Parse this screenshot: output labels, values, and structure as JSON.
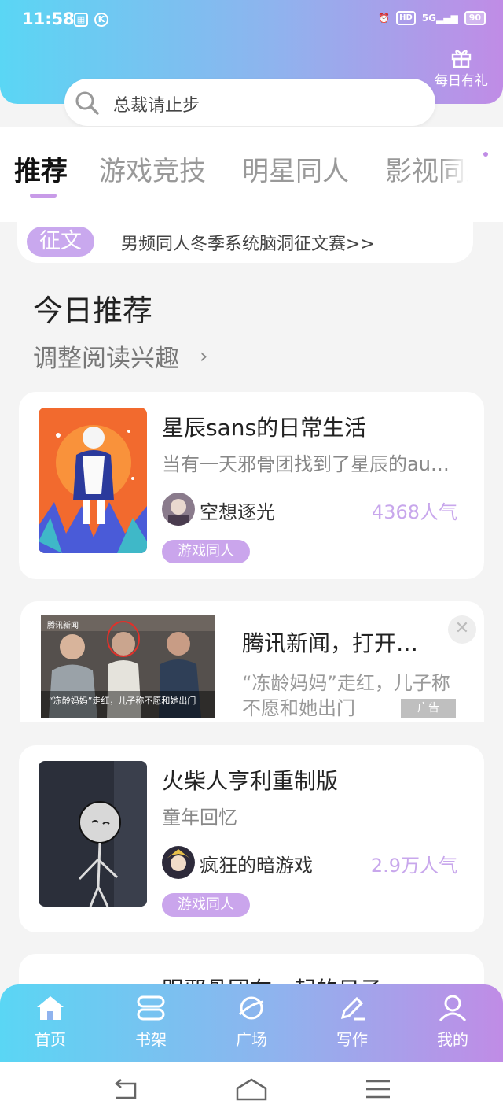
{
  "status_bar": {
    "time": "11:58",
    "network": "5G",
    "hd": "HD",
    "battery": "90"
  },
  "header": {
    "gift_label": "每日有礼",
    "search_text": "总裁请止步"
  },
  "tabs": [
    {
      "label": "推荐",
      "active": true
    },
    {
      "label": "游戏竞技",
      "active": false
    },
    {
      "label": "明星同人",
      "active": false
    },
    {
      "label": "影视同人",
      "active": false
    }
  ],
  "notice": {
    "tag": "征文",
    "text": "男频同人冬季系统脑洞征文赛>>"
  },
  "section": {
    "title": "今日推荐",
    "subtitle": "调整阅读兴趣"
  },
  "cards": [
    {
      "title": "星辰sans的日常生活",
      "desc": "当有一天邪骨团找到了星辰的au…",
      "author": "空想逐光",
      "popularity": "4368人气",
      "tag": "游戏同人"
    },
    {
      "title": "火柴人亨利重制版",
      "desc": "童年回忆",
      "author": "疯狂的暗游戏",
      "popularity": "2.9万人气",
      "tag": "游戏同人"
    },
    {
      "title": "跟邪骨团在一起的日子",
      "desc": "",
      "author": "",
      "popularity": "",
      "tag": ""
    }
  ],
  "ad": {
    "title": "腾讯新闻，打开…",
    "desc": "“冻龄妈妈”走红，儿子称不愿和她出门",
    "badge": "广告",
    "image_caption": "“冻龄妈妈”走红，儿子称不愿和她出门",
    "image_source": "腾讯新闻"
  },
  "bottom_nav": [
    {
      "label": "首页",
      "icon": "home-icon",
      "active": true
    },
    {
      "label": "书架",
      "icon": "bookshelf-icon",
      "active": false
    },
    {
      "label": "广场",
      "icon": "planet-icon",
      "active": false
    },
    {
      "label": "写作",
      "icon": "pen-icon",
      "active": false
    },
    {
      "label": "我的",
      "icon": "user-icon",
      "active": false
    }
  ],
  "colors": {
    "accent": "#c9a8ee",
    "gradient_start": "#5ad6f4",
    "gradient_end": "#c08ce6",
    "popularity": "#c8a7ec"
  }
}
